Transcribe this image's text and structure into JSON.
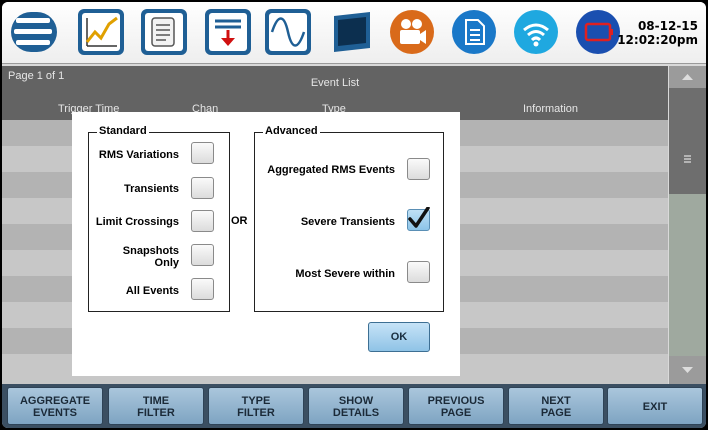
{
  "toolbar": {
    "icons": [
      "menu-icon",
      "trend-graph-icon",
      "scroll-log-icon",
      "filter-download-icon",
      "waveform-icon",
      "display-screen-icon",
      "video-camera-icon",
      "document-icon",
      "wifi-icon",
      "battery-icon"
    ],
    "date": "08-12-15",
    "time": "12:02:20pm"
  },
  "event_list": {
    "page_label": "Page 1 of 1",
    "title": "Event List",
    "columns": [
      "Trigger Time",
      "Chan",
      "Type",
      "Information"
    ]
  },
  "dialog": {
    "standard": {
      "legend": "Standard",
      "options": [
        {
          "label": "RMS Variations",
          "checked": false
        },
        {
          "label": "Transients",
          "checked": false
        },
        {
          "label": "Limit Crossings",
          "checked": false
        },
        {
          "label_line1": "Snapshots",
          "label_line2": "Only",
          "checked": false
        },
        {
          "label": "All Events",
          "checked": false
        }
      ]
    },
    "or_label": "OR",
    "advanced": {
      "legend": "Advanced",
      "options": [
        {
          "label": "Aggregated RMS Events",
          "checked": false
        },
        {
          "label": "Severe Transients",
          "checked": true
        },
        {
          "label": "Most Severe within",
          "checked": false
        }
      ]
    },
    "ok_label": "OK"
  },
  "function_keys": [
    {
      "line1": "AGGREGATE",
      "line2": "EVENTS"
    },
    {
      "line1": "TIME",
      "line2": "FILTER"
    },
    {
      "line1": "TYPE",
      "line2": "FILTER"
    },
    {
      "line1": "SHOW",
      "line2": "DETAILS"
    },
    {
      "line1": "PREVIOUS",
      "line2": "PAGE"
    },
    {
      "line1": "NEXT",
      "line2": "PAGE"
    },
    {
      "line1": "EXIT",
      "line2": ""
    }
  ]
}
